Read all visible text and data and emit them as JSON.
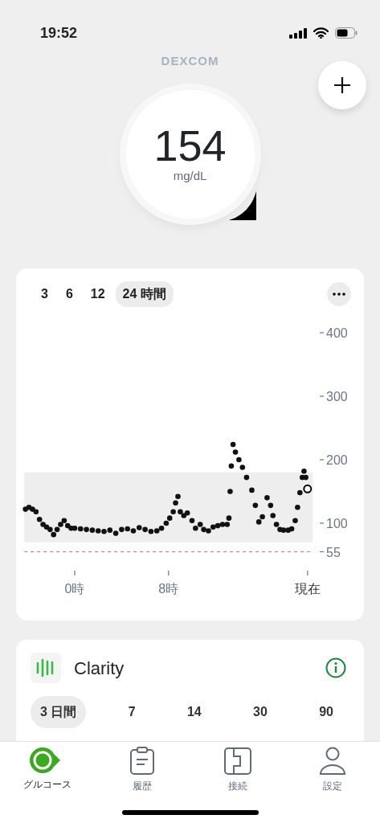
{
  "status_bar": {
    "time": "19:52"
  },
  "header": {
    "logo": "DEXCOM"
  },
  "reading": {
    "value": "154",
    "unit": "mg/dL"
  },
  "trend_chart": {
    "ranges": [
      {
        "label": "3",
        "selected": false
      },
      {
        "label": "6",
        "selected": false
      },
      {
        "label": "12",
        "selected": false
      },
      {
        "label": "24 時間",
        "selected": true
      }
    ],
    "chart_data": {
      "type": "scatter",
      "xlim": [
        -4.3,
        20.3
      ],
      "ylim": [
        55,
        400
      ],
      "xticks": [
        {
          "value": 0,
          "label": "0時"
        },
        {
          "value": 8,
          "label": "8時"
        },
        {
          "value": 19.85,
          "label": "現在"
        }
      ],
      "yticks": [
        400,
        300,
        200,
        100,
        55
      ],
      "x": [
        -4.2,
        -3.9,
        -3.6,
        -3.3,
        -3,
        -2.7,
        -2.4,
        -2.1,
        -1.8,
        -1.5,
        -1.2,
        -0.9,
        -0.6,
        -0.3,
        0,
        0.5,
        1,
        1.5,
        2,
        2.5,
        3,
        3.5,
        4,
        4.5,
        5,
        5.5,
        6,
        6.5,
        7,
        7.4,
        7.8,
        8.1,
        8.4,
        8.6,
        8.8,
        9,
        9.3,
        9.6,
        10,
        10.3,
        10.7,
        11,
        11.4,
        11.8,
        12.2,
        12.6,
        13,
        13.15,
        13.25,
        13.35,
        13.5,
        13.7,
        14,
        14.3,
        14.65,
        15.1,
        15.4,
        15.7,
        16,
        16.4,
        16.7,
        16.9,
        17.2,
        17.5,
        17.8,
        18.2,
        18.5,
        18.8,
        19,
        19.2,
        19.4,
        19.55,
        19.7,
        19.85
      ],
      "series": [
        {
          "color": "#111111",
          "values": [
            122,
            125,
            122,
            118,
            106,
            98,
            94,
            90,
            82,
            90,
            98,
            104,
            96,
            92,
            92,
            91,
            90,
            89,
            88,
            87,
            89,
            84,
            90,
            91,
            88,
            93,
            90,
            87,
            88,
            92,
            100,
            108,
            118,
            132,
            142,
            118,
            112,
            116,
            104,
            92,
            98,
            90,
            88,
            94,
            96,
            98,
            98,
            108,
            150,
            190,
            224,
            212,
            200,
            188,
            172,
            152,
            128,
            102,
            110,
            140,
            128,
            112,
            98,
            90,
            89,
            89,
            91,
            104,
            125,
            148,
            172,
            182,
            172,
            null
          ]
        },
        {
          "color": "#000000",
          "values": [
            null,
            null,
            null,
            null,
            null,
            null,
            null,
            null,
            null,
            null,
            null,
            null,
            null,
            null,
            null,
            null,
            null,
            null,
            null,
            null,
            null,
            null,
            null,
            null,
            null,
            null,
            null,
            null,
            null,
            null,
            null,
            null,
            null,
            null,
            null,
            null,
            null,
            null,
            null,
            null,
            null,
            null,
            null,
            null,
            null,
            null,
            null,
            null,
            null,
            null,
            null,
            null,
            null,
            null,
            null,
            null,
            null,
            null,
            null,
            null,
            null,
            null,
            null,
            null,
            null,
            null,
            null,
            null,
            null,
            null,
            null,
            null,
            null,
            154
          ]
        }
      ],
      "bands": [
        {
          "axis": "y",
          "from": 70,
          "to": 180
        }
      ],
      "ref_lines": [
        {
          "axis": "y",
          "value": 55
        }
      ]
    }
  },
  "clarity": {
    "title": "Clarity",
    "ranges": [
      {
        "label": "3 日間",
        "selected": true
      },
      {
        "label": "7",
        "selected": false
      },
      {
        "label": "14",
        "selected": false
      },
      {
        "label": "30",
        "selected": false
      },
      {
        "label": "90",
        "selected": false
      }
    ]
  },
  "tab_bar": [
    {
      "kind": "glucose",
      "label": "グルコース",
      "selected": true
    },
    {
      "kind": "history",
      "label": "履歴",
      "selected": false
    },
    {
      "kind": "connection",
      "label": "接続",
      "selected": false
    },
    {
      "kind": "settings",
      "label": "設定",
      "selected": false
    }
  ]
}
